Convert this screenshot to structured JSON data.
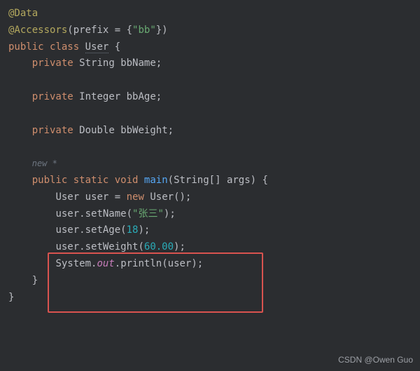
{
  "code": {
    "line1_annotation": "@Data",
    "line2_annotation": "@Accessors",
    "line2_prefix_key": "prefix",
    "line2_prefix_val": "\"bb\"",
    "line3_public": "public",
    "line3_class": "class",
    "line3_name": "User",
    "field1_mod": "private",
    "field1_type": "String",
    "field1_name": "bbName",
    "field2_mod": "private",
    "field2_type": "Integer",
    "field2_name": "bbAge",
    "field3_mod": "private",
    "field3_type": "Double",
    "field3_name": "bbWeight",
    "hint": "new *",
    "main_public": "public",
    "main_static": "static",
    "main_void": "void",
    "main_name": "main",
    "main_param_type": "String[]",
    "main_param_name": "args",
    "decl_type": "User",
    "decl_var": "user",
    "decl_new": "new",
    "decl_ctor": "User",
    "set1_obj": "user",
    "set1_method": "setName",
    "set1_arg": "\"张三\"",
    "set2_obj": "user",
    "set2_method": "setAge",
    "set2_arg": "18",
    "set3_obj": "user",
    "set3_method": "setWeight",
    "set3_arg": "60.00",
    "print_class": "System",
    "print_out": "out",
    "print_method": "println",
    "print_arg": "user"
  },
  "watermark": "CSDN @Owen Guo"
}
